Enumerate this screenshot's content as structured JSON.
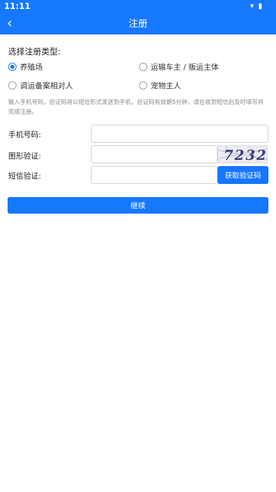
{
  "status_bar": {
    "time": "11:11"
  },
  "header": {
    "title": "注册"
  },
  "register_type": {
    "title": "选择注册类型:",
    "options": [
      {
        "label": "养殖场",
        "selected": true
      },
      {
        "label": "运输车主 / 贩运主体",
        "selected": false
      },
      {
        "label": "调运备案相对人",
        "selected": false
      },
      {
        "label": "宠物主人",
        "selected": false
      }
    ]
  },
  "hint": "输入手机号码，验证码将以短信形式发送到手机，验证码有效期5分钟，请在收到短信后及时填写并完成注册。",
  "form": {
    "phone_label": "手机号码:",
    "phone_value": "",
    "captcha_label": "图形验证:",
    "captcha_value": "",
    "captcha_image_text": "7232",
    "sms_label": "短信验证:",
    "sms_value": "",
    "sms_button": "获取验证码"
  },
  "continue_button": "继续",
  "colors": {
    "accent": "#1677ff"
  }
}
